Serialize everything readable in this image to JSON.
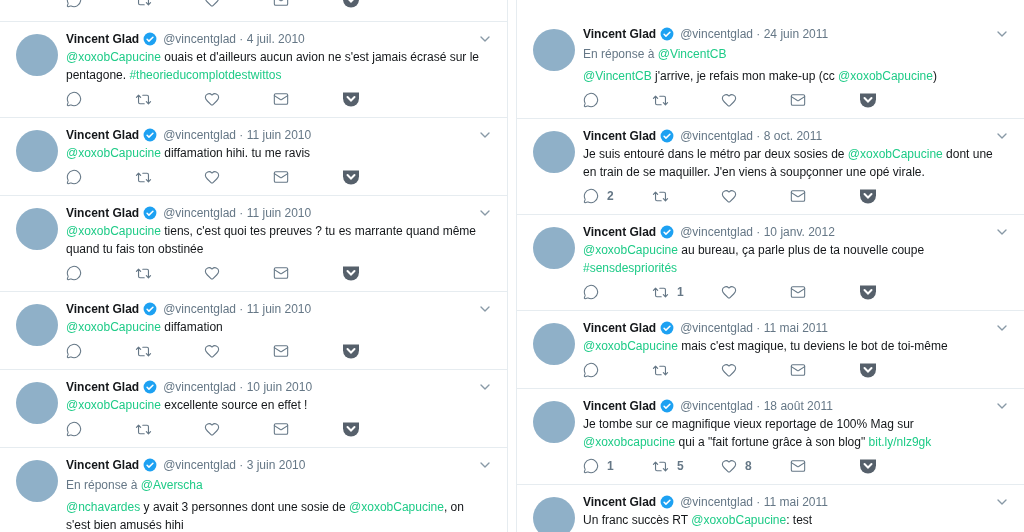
{
  "columns": [
    {
      "items": [
        {
          "kind": "cut_actions"
        },
        {
          "kind": "tweet",
          "name": "Vincent Glad",
          "meta": "@vincentglad · 4 juil. 2010",
          "body": [
            {
              "kind": "mention",
              "text": "@xoxobCapucine"
            },
            {
              "kind": "text",
              "text": " ouais et d'ailleurs aucun avion ne s'est jamais écrasé sur le pentagone. "
            },
            {
              "kind": "hashtag",
              "text": "#theorieducomplotdestwittos"
            }
          ]
        },
        {
          "kind": "tweet",
          "name": "Vincent Glad",
          "meta": "@vincentglad · 11 juin 2010",
          "body": [
            {
              "kind": "mention",
              "text": "@xoxobCapucine"
            },
            {
              "kind": "text",
              "text": " diffamation hihi. tu me ravis"
            }
          ]
        },
        {
          "kind": "tweet",
          "name": "Vincent Glad",
          "meta": "@vincentglad · 11 juin 2010",
          "body": [
            {
              "kind": "mention",
              "text": "@xoxobCapucine"
            },
            {
              "kind": "text",
              "text": " tiens, c'est quoi tes preuves ? tu es marrante quand même quand tu fais ton obstinée"
            }
          ]
        },
        {
          "kind": "tweet",
          "name": "Vincent Glad",
          "meta": "@vincentglad · 11 juin 2010",
          "body": [
            {
              "kind": "mention",
              "text": "@xoxobCapucine"
            },
            {
              "kind": "text",
              "text": " diffamation"
            }
          ]
        },
        {
          "kind": "tweet",
          "name": "Vincent Glad",
          "meta": "@vincentglad · 10 juin 2010",
          "body": [
            {
              "kind": "mention",
              "text": "@xoxobCapucine"
            },
            {
              "kind": "text",
              "text": " excellente source en effet !"
            }
          ]
        },
        {
          "kind": "tweet",
          "name": "Vincent Glad",
          "meta": "@vincentglad · 3 juin 2010",
          "reply_to": {
            "label": "En réponse à",
            "handle": "@Averscha"
          },
          "body": [
            {
              "kind": "mention",
              "text": "@nchavardes"
            },
            {
              "kind": "text",
              "text": " y avait 3 personnes dont une sosie de "
            },
            {
              "kind": "mention",
              "text": "@xoxobCapucine"
            },
            {
              "kind": "text",
              "text": ", on s'est bien amusés hihi"
            }
          ]
        }
      ]
    },
    {
      "items": [
        {
          "kind": "tweet",
          "name": "Vincent Glad",
          "meta": "@vincentglad · 24 juin 2011",
          "reply_to": {
            "label": "En réponse à",
            "handle": "@VincentCB"
          },
          "body": [
            {
              "kind": "mention",
              "text": "@VincentCB"
            },
            {
              "kind": "text",
              "text": " j'arrive, je refais mon make-up (cc "
            },
            {
              "kind": "mention",
              "text": "@xoxobCapucine"
            },
            {
              "kind": "text",
              "text": ")"
            }
          ]
        },
        {
          "kind": "tweet",
          "name": "Vincent Glad",
          "meta": "@vincentglad · 8 oct. 2011",
          "body": [
            {
              "kind": "text",
              "text": "Je suis entouré dans le métro par deux sosies de "
            },
            {
              "kind": "mention",
              "text": "@xoxobCapucine"
            },
            {
              "kind": "text",
              "text": " dont une en train de se maquiller. J'en viens à soupçonner une opé virale."
            }
          ],
          "reply_count": "2"
        },
        {
          "kind": "tweet",
          "name": "Vincent Glad",
          "meta": "@vincentglad · 10 janv. 2012",
          "body": [
            {
              "kind": "mention",
              "text": "@xoxobCapucine"
            },
            {
              "kind": "text",
              "text": " au bureau, ça parle plus de ta nouvelle coupe "
            },
            {
              "kind": "hashtag",
              "text": "#sensdespriorités"
            }
          ],
          "retweet_count": "1"
        },
        {
          "kind": "tweet",
          "name": "Vincent Glad",
          "meta": "@vincentglad · 11 mai 2011",
          "body": [
            {
              "kind": "mention",
              "text": "@xoxobCapucine"
            },
            {
              "kind": "text",
              "text": " mais c'est magique, tu deviens le bot de toi-même"
            }
          ]
        },
        {
          "kind": "tweet",
          "name": "Vincent Glad",
          "meta": "@vincentglad · 18 août 2011",
          "body": [
            {
              "kind": "text",
              "text": "Je tombe sur ce magnifique vieux reportage de 100% Mag sur "
            },
            {
              "kind": "mention",
              "text": "@xoxobcapucine"
            },
            {
              "kind": "text",
              "text": " qui a \"fait fortune grâce à son blog\" "
            },
            {
              "kind": "url",
              "text": "bit.ly/nlz9gk"
            }
          ],
          "reply_count": "1",
          "retweet_count": "5",
          "like_count": "8"
        },
        {
          "kind": "tweet",
          "name": "Vincent Glad",
          "meta": "@vincentglad · 11 mai 2011",
          "body": [
            {
              "kind": "text",
              "text": "Un franc succès RT "
            },
            {
              "kind": "mention",
              "text": "@xoxobCapucine"
            },
            {
              "kind": "text",
              "text": ": test"
            }
          ]
        }
      ]
    }
  ]
}
